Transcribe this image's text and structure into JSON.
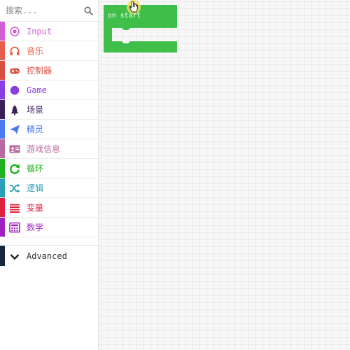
{
  "search": {
    "placeholder": "搜索..."
  },
  "toolbox": {
    "categories": [
      {
        "label": "Input",
        "color": "#d35ed5",
        "icon": "radio-target-icon"
      },
      {
        "label": "音乐",
        "color": "#e55e4b",
        "icon": "headphones-icon"
      },
      {
        "label": "控制器",
        "color": "#d94f42",
        "icon": "gamepad-icon"
      },
      {
        "label": "Game",
        "color": "#8a3ee0",
        "icon": "circle-icon"
      },
      {
        "label": "场景",
        "color": "#3b1f5a",
        "icon": "tree-icon"
      },
      {
        "label": "精灵",
        "color": "#4b7bf0",
        "icon": "paper-plane-icon"
      },
      {
        "label": "游戏信息",
        "color": "#b56aa0",
        "icon": "id-card-icon"
      },
      {
        "label": "循环",
        "color": "#20b020",
        "icon": "refresh-icon"
      },
      {
        "label": "逻辑",
        "color": "#2b9fb3",
        "icon": "shuffle-icon"
      },
      {
        "label": "变量",
        "color": "#e0203f",
        "icon": "list-icon"
      },
      {
        "label": "数学",
        "color": "#a020c0",
        "icon": "calculator-icon"
      }
    ],
    "advanced": {
      "label": "Advanced",
      "color": "#17283a",
      "icon": "chevron-down-icon"
    }
  },
  "workspace": {
    "block": {
      "label": "on start",
      "color": "#3fbf4a"
    }
  }
}
